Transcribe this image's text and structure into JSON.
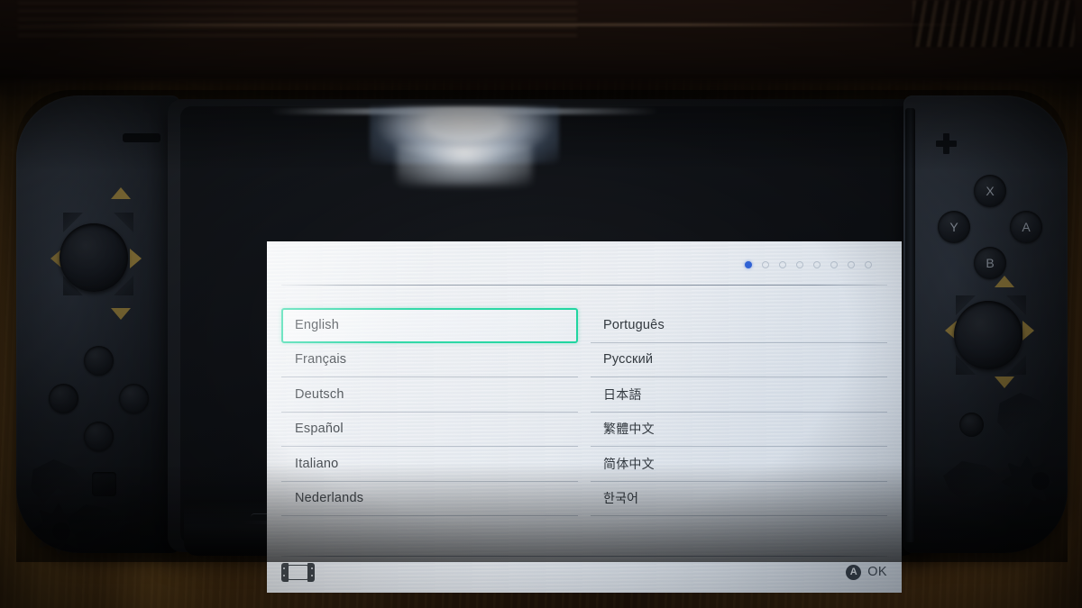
{
  "device": {
    "name": "Nintendo Switch",
    "edition_note": "Monster Hunter special edition Joy-Con",
    "left_joycon": {
      "name": "left-joycon",
      "buttons": [
        "capture",
        "minus-rail",
        "stick",
        "dpad-up",
        "dpad-down",
        "dpad-left",
        "dpad-right"
      ]
    },
    "right_joycon": {
      "name": "right-joycon",
      "plus_label": "+",
      "face_buttons": [
        "X",
        "Y",
        "A",
        "B"
      ],
      "home_label": ""
    }
  },
  "screen": {
    "pager": {
      "total": 8,
      "active_index": 0
    },
    "title": "",
    "languages": {
      "left_column": [
        "English",
        "Français",
        "Deutsch",
        "Español",
        "Italiano",
        "Nederlands"
      ],
      "right_column": [
        "Português",
        "Русский",
        "日本語",
        "繁體中文",
        "简体中文",
        "한국어"
      ],
      "selected": "English"
    },
    "footer": {
      "console_icon": "switch-console-icon",
      "button_glyph": "A",
      "action_label": "OK"
    },
    "colors": {
      "selection_border": "#13d39b",
      "pager_active": "#2b5fd6",
      "pager_inactive": "#b9c2cd",
      "text": "#2c3238",
      "background": "#eceff3"
    }
  }
}
